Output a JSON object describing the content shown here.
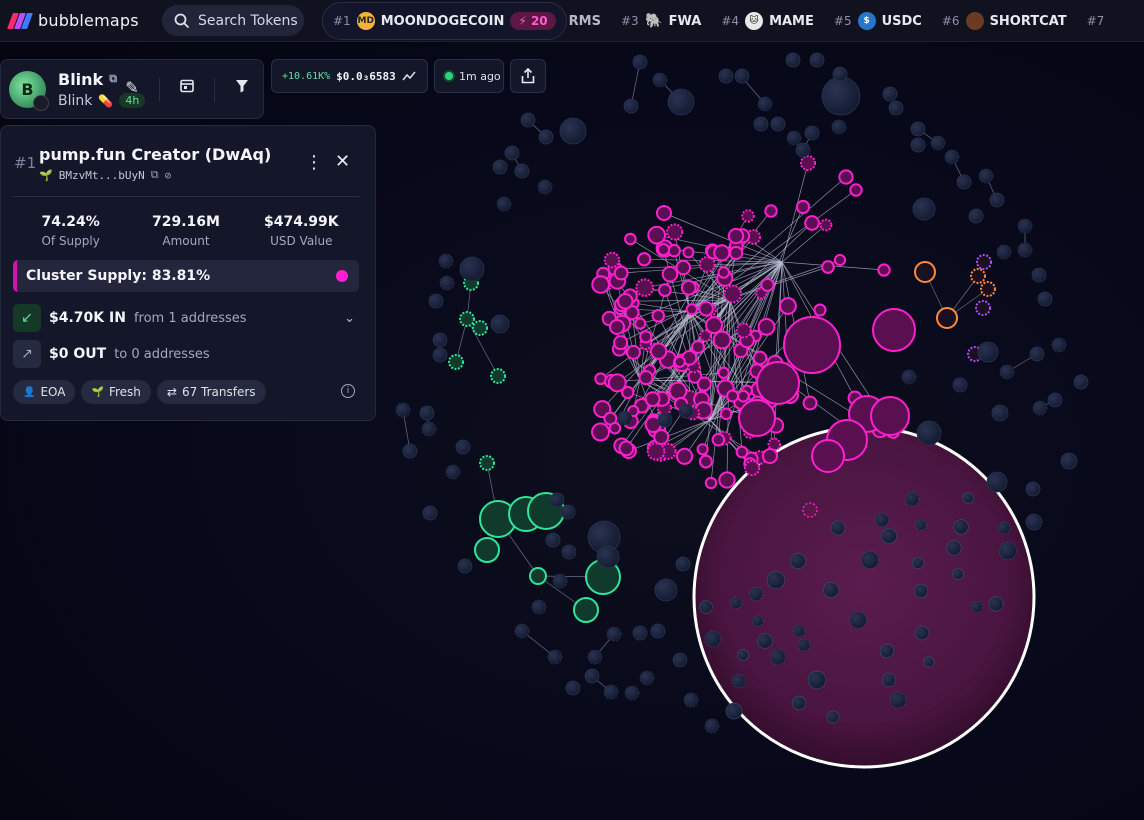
{
  "brand": {
    "name": "bubblemaps",
    "colors": [
      "#ff2b6b",
      "#b94dff",
      "#3f7bff"
    ]
  },
  "search": {
    "label": "Search Tokens",
    "icon": "search-icon"
  },
  "trending": [
    {
      "rank": "#1",
      "name": "MOONDOGECOIN",
      "boost": "20",
      "coin_color": "#f2b438",
      "coin_text": "MD"
    },
    {
      "rank": "",
      "name": "RMS",
      "partial": true
    },
    {
      "rank": "#3",
      "name": "FWA",
      "coin_color": "#ff8ab8",
      "coin_text": ""
    },
    {
      "rank": "#4",
      "name": "MAME",
      "coin_color": "#e8e8e8",
      "coin_text": ""
    },
    {
      "rank": "#5",
      "name": "USDC",
      "coin_color": "#2775ca",
      "coin_text": "$"
    },
    {
      "rank": "#6",
      "name": "SHORTCAT",
      "coin_color": "#8a4a2a",
      "coin_text": ""
    },
    {
      "rank": "#7",
      "name": "",
      "partial": true
    }
  ],
  "token": {
    "name": "Blink",
    "symbol": "Blink",
    "age": "4h",
    "avatar_text": "B"
  },
  "price": {
    "change": "+10.61K%",
    "value": "$0.0₃6583"
  },
  "updated": {
    "label": "1m ago"
  },
  "panel": {
    "rank": "#1",
    "title": "pump.fun Creator (DwAq)",
    "address": "BMzvMt...bUyN",
    "stats": [
      {
        "value": "74.24%",
        "label": "Of Supply"
      },
      {
        "value": "729.16M",
        "label": "Amount"
      },
      {
        "value": "$474.99K",
        "label": "USD Value"
      }
    ],
    "cluster_supply": "Cluster Supply: 83.81%",
    "inflow": {
      "amount": "$4.70K IN",
      "desc": "from 1 addresses"
    },
    "outflow": {
      "amount": "$0 OUT",
      "desc": "to 0 addresses"
    },
    "tags": [
      "EOA",
      "Fresh",
      "67 Transfers"
    ]
  },
  "colors": {
    "magenta": "#ff1fcf",
    "green": "#2ee59a",
    "orange": "#ff8a3a",
    "purple": "#b04dff",
    "node": "#1c2440"
  }
}
